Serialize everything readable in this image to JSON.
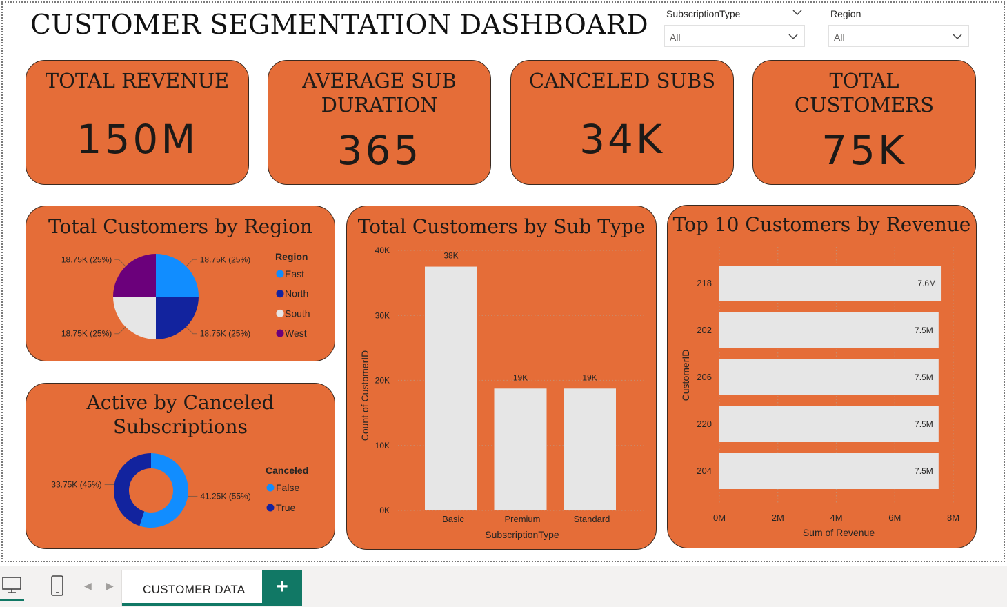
{
  "dashboard": {
    "title": "CUSTOMER SEGMENTATION DASHBOARD"
  },
  "slicers": [
    {
      "label": "SubscriptionType",
      "value": "All"
    },
    {
      "label": "Region",
      "value": "All"
    }
  ],
  "kpis": [
    {
      "title": "TOTAL REVENUE",
      "value": "150M"
    },
    {
      "title": "AVERAGE SUB DURATION",
      "value": "365"
    },
    {
      "title": "CANCELED SUBS",
      "value": "34K"
    },
    {
      "title": "TOTAL CUSTOMERS",
      "value": "75K"
    }
  ],
  "colors": {
    "card_bg": "#e56d38",
    "east": "#118dff",
    "north": "#12239e",
    "south": "#e6e6e6",
    "west": "#6b007b",
    "false": "#118dff",
    "true": "#12239e",
    "bar": "#e6e6e6",
    "accent": "#117865"
  },
  "chart_data": [
    {
      "type": "pie",
      "title": "Total Customers by Region",
      "legend_title": "Region",
      "legend_position": "right",
      "categories": [
        "East",
        "North",
        "South",
        "West"
      ],
      "values": [
        18750,
        18750,
        18750,
        18750
      ],
      "data_labels": [
        "18.75K (25%)",
        "18.75K (25%)",
        "18.75K (25%)",
        "18.75K (25%)"
      ]
    },
    {
      "type": "pie",
      "subtype": "donut",
      "title": "Active by Canceled Subscriptions",
      "legend_title": "Canceled",
      "legend_position": "right",
      "categories": [
        "False",
        "True"
      ],
      "values": [
        41250,
        33750
      ],
      "data_labels": [
        "41.25K (55%)",
        "33.75K (45%)"
      ]
    },
    {
      "type": "bar",
      "title": "Total Customers by Sub Type",
      "xlabel": "SubscriptionType",
      "ylabel": "Count of CustomerID",
      "categories": [
        "Basic",
        "Premium",
        "Standard"
      ],
      "values": [
        37500,
        18750,
        18750
      ],
      "data_labels": [
        "38K",
        "19K",
        "19K"
      ],
      "ylim": [
        0,
        40000
      ],
      "yticks": [
        "0K",
        "10K",
        "20K",
        "30K",
        "40K"
      ],
      "grid": true
    },
    {
      "type": "bar",
      "orientation": "horizontal",
      "title": "Top 10 Customers by Revenue",
      "xlabel": "Sum of Revenue",
      "ylabel": "CustomerID",
      "categories": [
        "218",
        "202",
        "206",
        "220",
        "204"
      ],
      "values": [
        7600000,
        7500000,
        7500000,
        7500000,
        7500000
      ],
      "data_labels": [
        "7.6M",
        "7.5M",
        "7.5M",
        "7.5M",
        "7.5M"
      ],
      "xlim": [
        0,
        8000000
      ],
      "xticks": [
        "0M",
        "2M",
        "4M",
        "6M",
        "8M"
      ],
      "grid": true
    }
  ],
  "footer": {
    "page_tab": "CUSTOMER DATA",
    "add_page": "+"
  }
}
